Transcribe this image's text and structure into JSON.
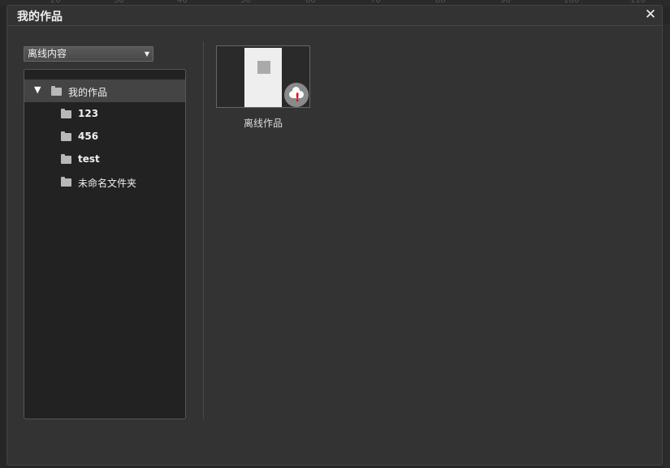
{
  "dialog": {
    "title": "我的作品",
    "close_label": "✕"
  },
  "source_dropdown": {
    "value": "离线内容",
    "arrow": "▼"
  },
  "tree": {
    "toggle": "▼",
    "root": {
      "label": "我的作品",
      "expanded": true,
      "selected": true
    },
    "children": [
      {
        "label": "123"
      },
      {
        "label": "456"
      },
      {
        "label": "test"
      },
      {
        "label": "未命名文件夹"
      }
    ]
  },
  "works": [
    {
      "title": "离线作品",
      "status_icon": "cloud-alert-icon",
      "alert_glyph": "!"
    }
  ],
  "colors": {
    "dialog_bg": "#333333",
    "panel_bg": "#222222",
    "selected_row": "#444444",
    "alert": "#e00000"
  }
}
